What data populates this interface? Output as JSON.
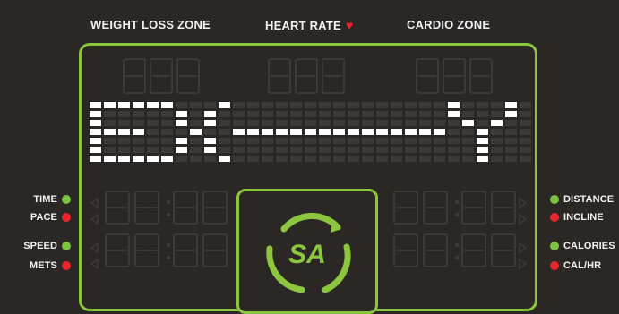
{
  "header": {
    "weight_loss_zone": "WEIGHT LOSS ZONE",
    "heart_rate": "HEART RATE",
    "cardio_zone": "CARDIO ZONE"
  },
  "display": {
    "message": "EX---Y",
    "colors": {
      "accent": "#8cc63f",
      "lit": "#ffffff",
      "unlit": "#3d3937",
      "red": "#e8262d",
      "background": "#2b2725"
    }
  },
  "indicators": {
    "left": [
      {
        "label": "TIME",
        "color": "green"
      },
      {
        "label": "PACE",
        "color": "red"
      },
      {
        "label": "SPEED",
        "color": "green"
      },
      {
        "label": "METS",
        "color": "red"
      }
    ],
    "right": [
      {
        "label": "DISTANCE",
        "color": "green"
      },
      {
        "label": "INCLINE",
        "color": "red"
      },
      {
        "label": "CALORIES",
        "color": "green"
      },
      {
        "label": "CAL/HR",
        "color": "red"
      }
    ]
  },
  "logo": {
    "text": "SA"
  }
}
